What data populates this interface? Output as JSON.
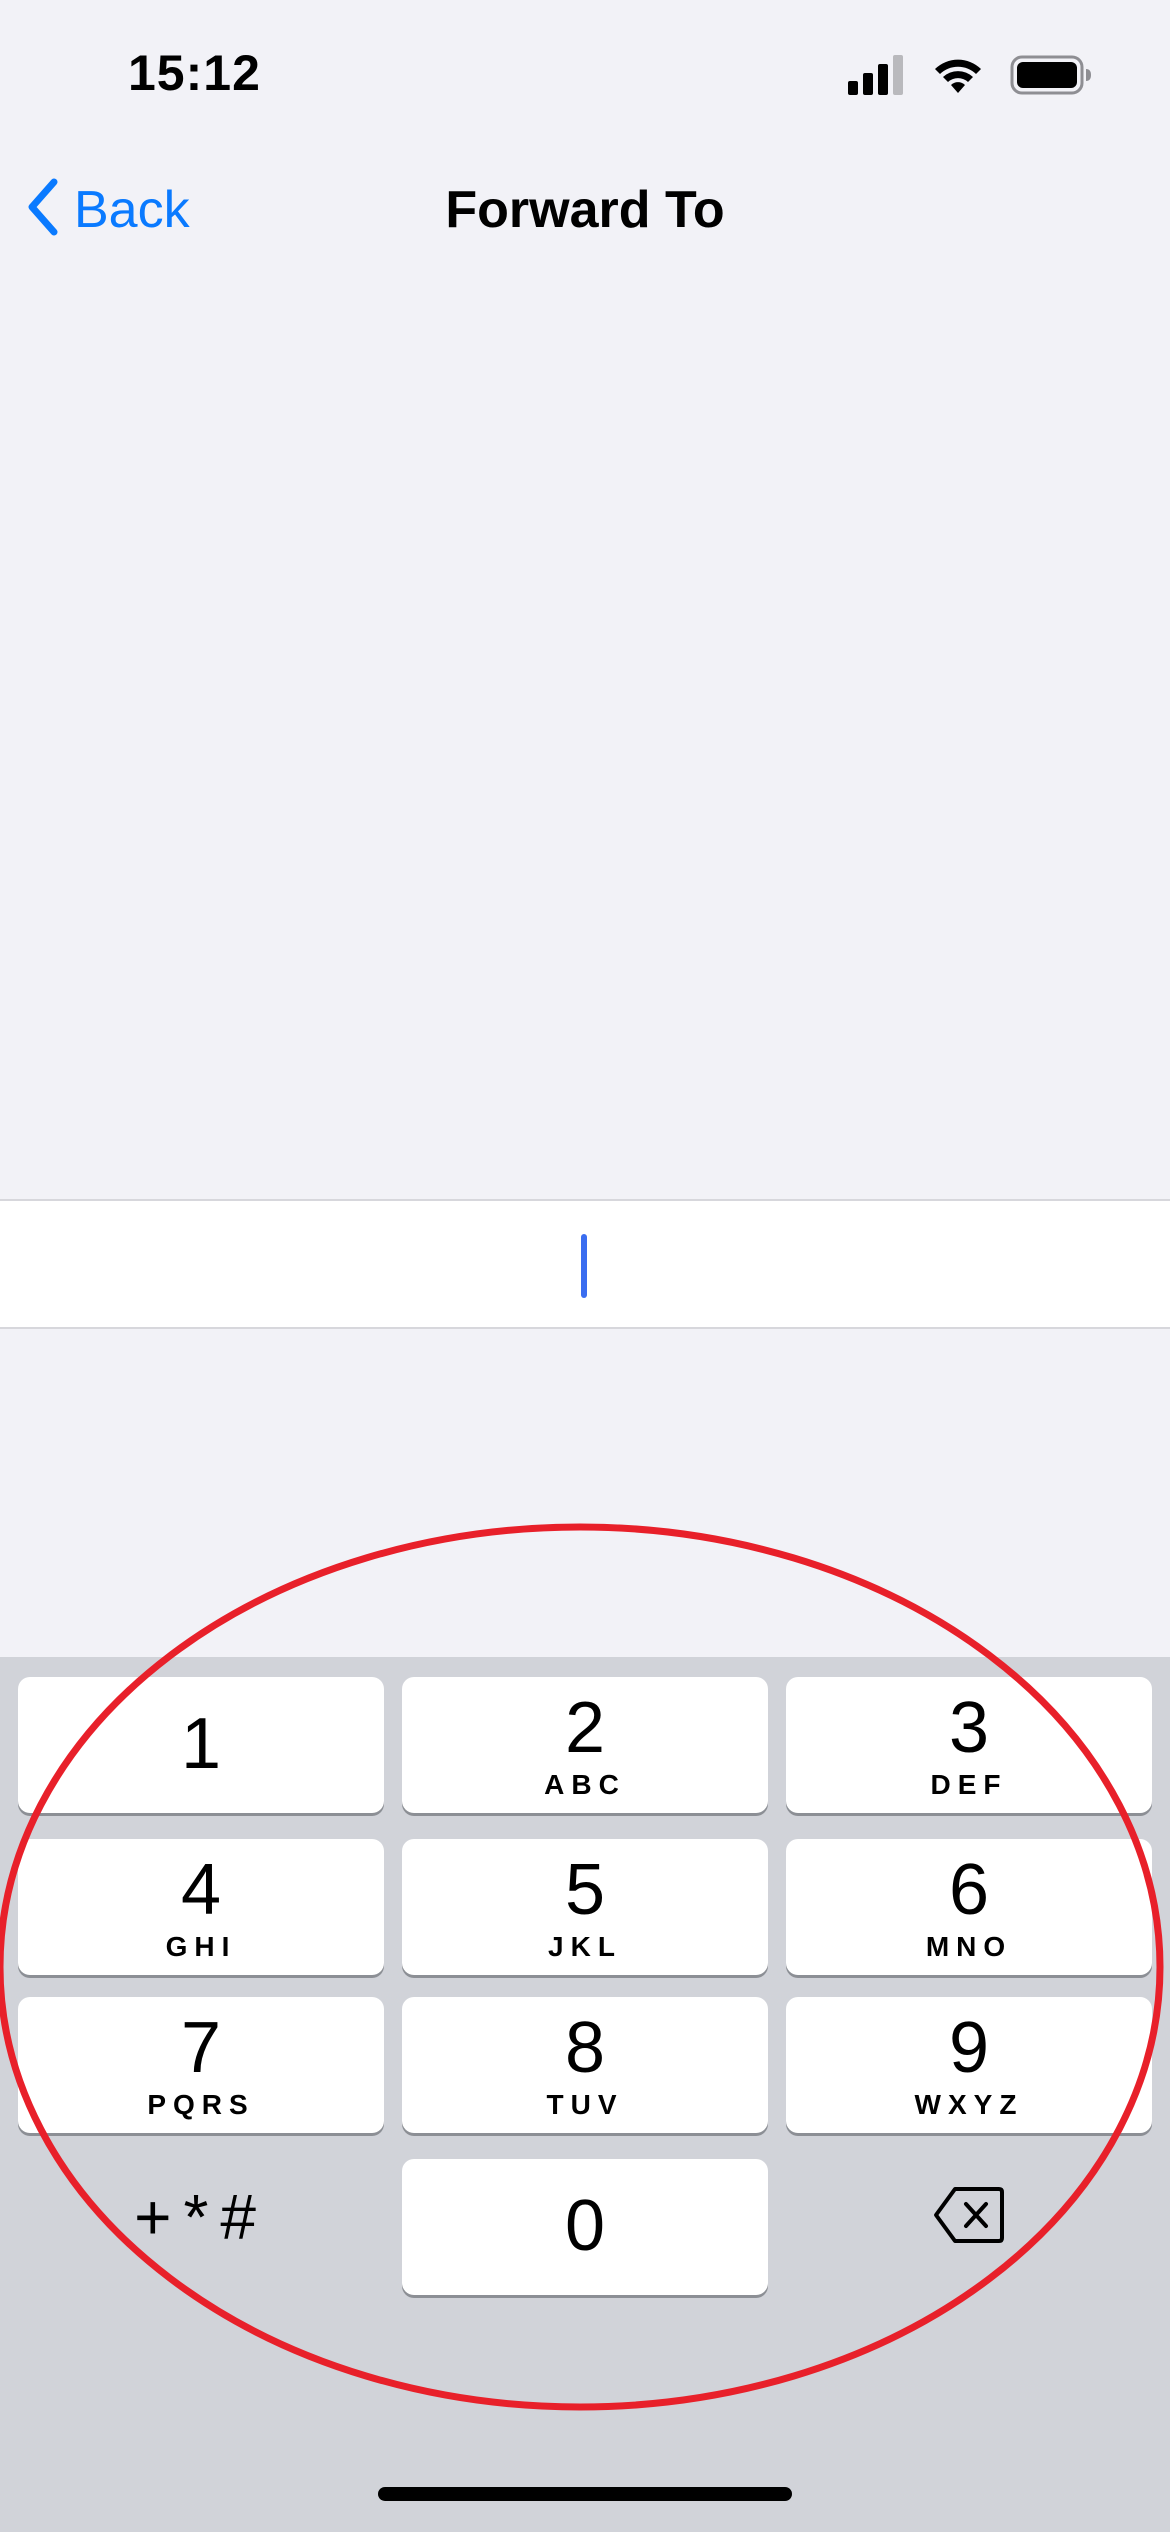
{
  "status_bar": {
    "time": "15:12",
    "icons": [
      "cellular-signal-icon",
      "wifi-icon",
      "battery-icon"
    ]
  },
  "nav": {
    "back_label": "Back",
    "title": "Forward To"
  },
  "input": {
    "value": "",
    "placeholder": ""
  },
  "keypad": {
    "keys": [
      {
        "digit": "1",
        "letters": ""
      },
      {
        "digit": "2",
        "letters": "ABC"
      },
      {
        "digit": "3",
        "letters": "DEF"
      },
      {
        "digit": "4",
        "letters": "GHI"
      },
      {
        "digit": "5",
        "letters": "JKL"
      },
      {
        "digit": "6",
        "letters": "MNO"
      },
      {
        "digit": "7",
        "letters": "PQRS"
      },
      {
        "digit": "8",
        "letters": "TUV"
      },
      {
        "digit": "9",
        "letters": "WXYZ"
      },
      {
        "digit": "0",
        "letters": ""
      }
    ],
    "symbols_label": "+*#",
    "delete_icon": "delete-backspace-icon"
  },
  "colors": {
    "accent": "#0a7aff",
    "background": "#f2f2f7",
    "keypad_background": "#d1d3d9",
    "cursor": "#3a6df0",
    "annotation": "#e8202a"
  }
}
